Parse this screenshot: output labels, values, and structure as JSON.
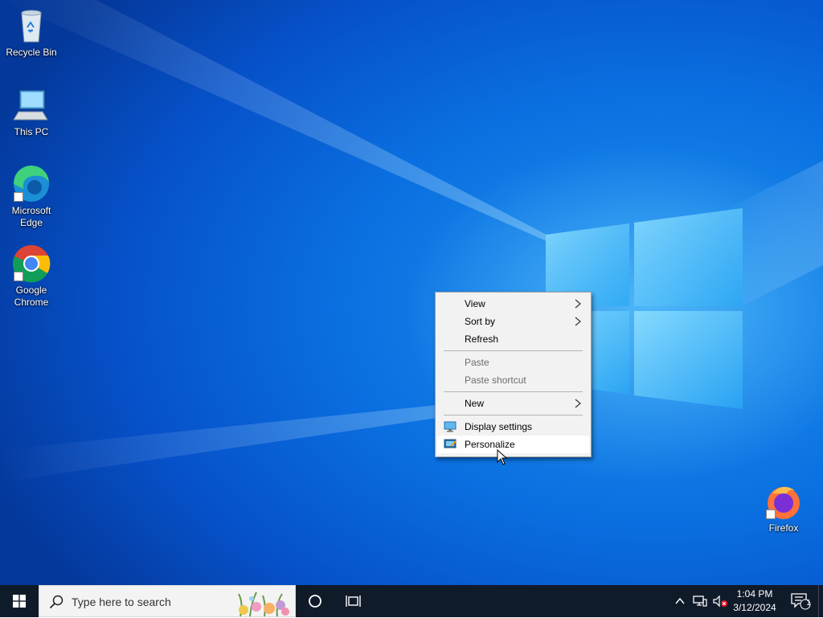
{
  "desktop": {
    "icons": [
      {
        "label": "Recycle Bin",
        "icon": "recycle-bin-icon"
      },
      {
        "label": "This PC",
        "icon": "computer-icon"
      },
      {
        "label": "Microsoft Edge",
        "icon": "edge-icon"
      },
      {
        "label": "Google Chrome",
        "icon": "chrome-icon"
      },
      {
        "label": "Firefox",
        "icon": "firefox-icon"
      }
    ]
  },
  "context_menu": {
    "items": [
      {
        "label": "View",
        "submenu": true
      },
      {
        "label": "Sort by",
        "submenu": true
      },
      {
        "label": "Refresh"
      },
      {
        "label": "Paste",
        "disabled": true
      },
      {
        "label": "Paste shortcut",
        "disabled": true
      },
      {
        "label": "New",
        "submenu": true
      },
      {
        "label": "Display settings",
        "icon": "display-settings-icon"
      },
      {
        "label": "Personalize",
        "icon": "personalize-icon",
        "hovered": true
      }
    ]
  },
  "taskbar": {
    "search_placeholder": "Type here to search",
    "clock_time": "1:04 PM",
    "clock_date": "3/12/2024",
    "notification_count": "1"
  },
  "colors": {
    "taskbar": "#101b2a",
    "menu_bg": "#f2f2f2",
    "desktop_accent": "#0a6fe0"
  }
}
